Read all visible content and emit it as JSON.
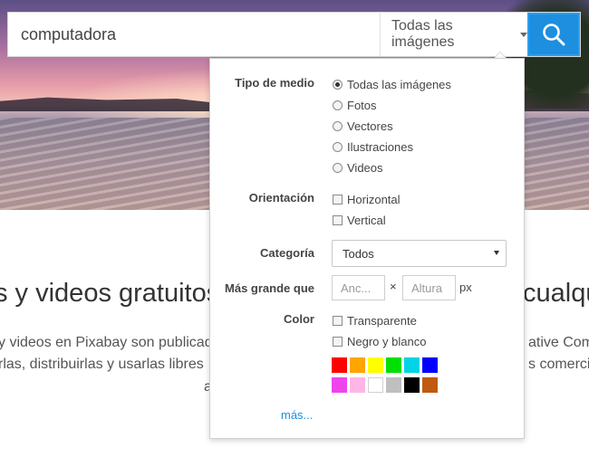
{
  "search": {
    "query": "computadora",
    "type_selected": "Todas las imágenes"
  },
  "background": {
    "headline_left": "s y videos gratuitos",
    "headline_right": "cualqu",
    "para1_left": "y videos en Pixabay son publicad",
    "para1_right": "ative Com",
    "para2_left": "rlas, distribuirlas y usarlas libres",
    "para2_right": "s comercia",
    "para3_left": "a"
  },
  "filters": {
    "media_type": {
      "label": "Tipo de medio",
      "options": [
        "Todas las imágenes",
        "Fotos",
        "Vectores",
        "Ilustraciones",
        "Videos"
      ],
      "selected": "Todas las imágenes"
    },
    "orientation": {
      "label": "Orientación",
      "options": [
        "Horizontal",
        "Vertical"
      ]
    },
    "category": {
      "label": "Categoría",
      "selected": "Todos"
    },
    "size": {
      "label": "Más grande que",
      "width_placeholder": "Anc...",
      "height_placeholder": "Altura",
      "separator": "×",
      "unit": "px"
    },
    "color": {
      "label": "Color",
      "options": [
        "Transparente",
        "Negro y blanco"
      ],
      "swatches_row1": [
        "#ff0000",
        "#ffa500",
        "#ffff00",
        "#00e000",
        "#00d4e6",
        "#0000ff"
      ],
      "swatches_row2": [
        "#ee44ee",
        "#ffb6e6",
        "#ffffff",
        "#bfbfbf",
        "#000000",
        "#c05a10"
      ]
    },
    "more_link": "más..."
  }
}
